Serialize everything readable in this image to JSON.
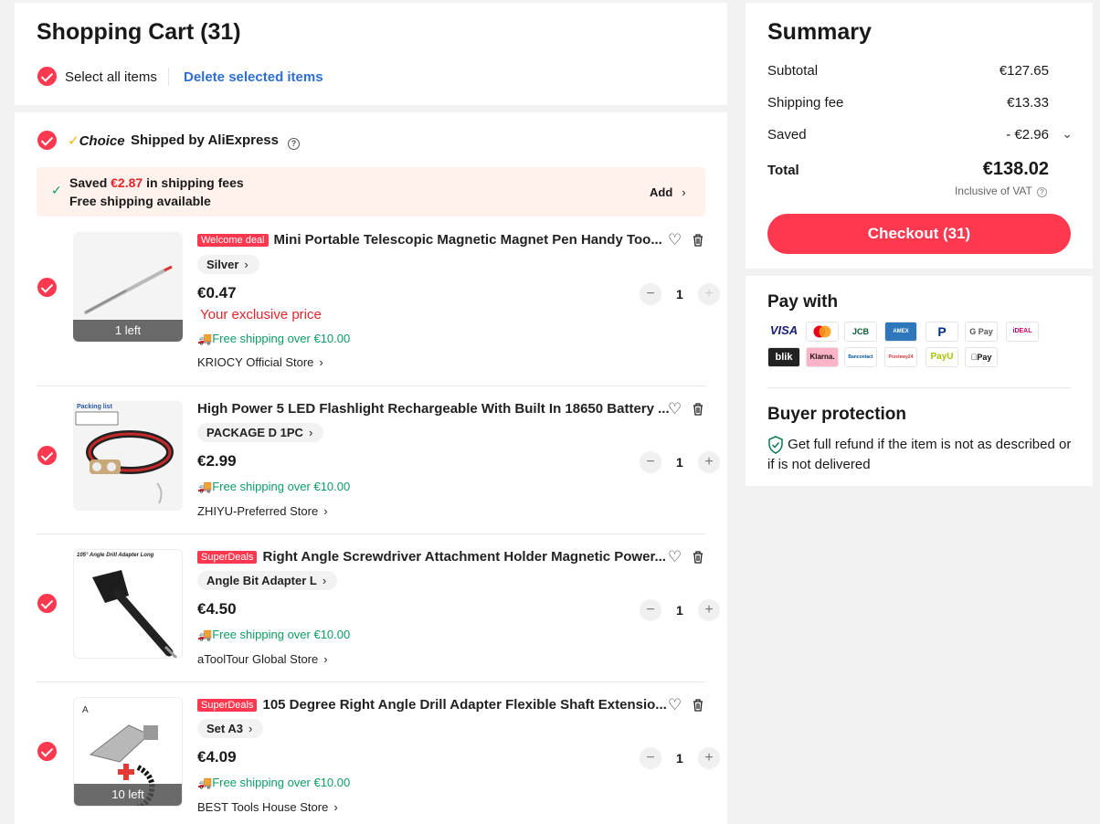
{
  "cart": {
    "title": "Shopping Cart (31)",
    "select_all_label": "Select all items",
    "delete_selected_label": "Delete selected items"
  },
  "choice": {
    "badge_label": "Choice",
    "shipped_by": "Shipped by AliExpress",
    "banner": {
      "saved_prefix": "Saved ",
      "saved_amount": "€2.87",
      "saved_suffix": " in shipping fees",
      "free_shipping": "Free shipping available",
      "add_label": "Add"
    }
  },
  "items": [
    {
      "badge": "Welcome deal",
      "title": "Mini Portable Telescopic Magnetic Magnet Pen Handy Too...",
      "variant": "Silver",
      "price": "€0.47",
      "exclusive": "Your exclusive price",
      "shipping": "Free shipping over €10.00",
      "store": "KRIOCY Official Store",
      "stock": "1 left",
      "qty": "1"
    },
    {
      "title": "High Power 5 LED Flashlight Rechargeable With Built In 18650 Battery ...",
      "variant": "PACKAGE D 1PC",
      "price": "€2.99",
      "shipping": "Free shipping over €10.00",
      "store": "ZHIYU-Preferred Store",
      "qty": "1",
      "img_text": "Packing list"
    },
    {
      "badge": "SuperDeals",
      "title": "Right Angle Screwdriver Attachment Holder Magnetic Power...",
      "variant": "Angle Bit Adapter L",
      "price": "€4.50",
      "shipping": "Free shipping over €10.00",
      "store": "aToolTour Global Store",
      "qty": "1",
      "img_text": "105° Angle Drill Adapter Long"
    },
    {
      "badge": "SuperDeals",
      "title": "105 Degree Right Angle Drill Adapter Flexible Shaft Extensio...",
      "variant": "Set A3",
      "price": "€4.09",
      "shipping": "Free shipping over €10.00",
      "store": "BEST Tools House Store",
      "stock": "10 left",
      "qty": "1",
      "img_text": "A"
    }
  ],
  "summary": {
    "title": "Summary",
    "subtotal_label": "Subtotal",
    "subtotal": "€127.65",
    "shipping_label": "Shipping fee",
    "shipping": "€13.33",
    "saved_label": "Saved",
    "saved": "- €2.96",
    "total_label": "Total",
    "total": "€138.02",
    "vat_note": "Inclusive of VAT",
    "checkout_label": "Checkout (31)"
  },
  "pay": {
    "title": "Pay with",
    "methods": [
      "VISA",
      "Mastercard",
      "JCB",
      "American Express",
      "PayPal",
      "G Pay",
      "iDEAL",
      "blik",
      "Klarna.",
      "Bancontact",
      "Przelewy24",
      "PayU",
      "Apple Pay"
    ]
  },
  "protection": {
    "title": "Buyer protection",
    "text": "Get full refund if the item is not as described or if is not delivered"
  },
  "colors": {
    "accent": "#fd384f",
    "link": "#2e6ed1",
    "green": "#0d9c63",
    "red_text": "#e4262b"
  }
}
